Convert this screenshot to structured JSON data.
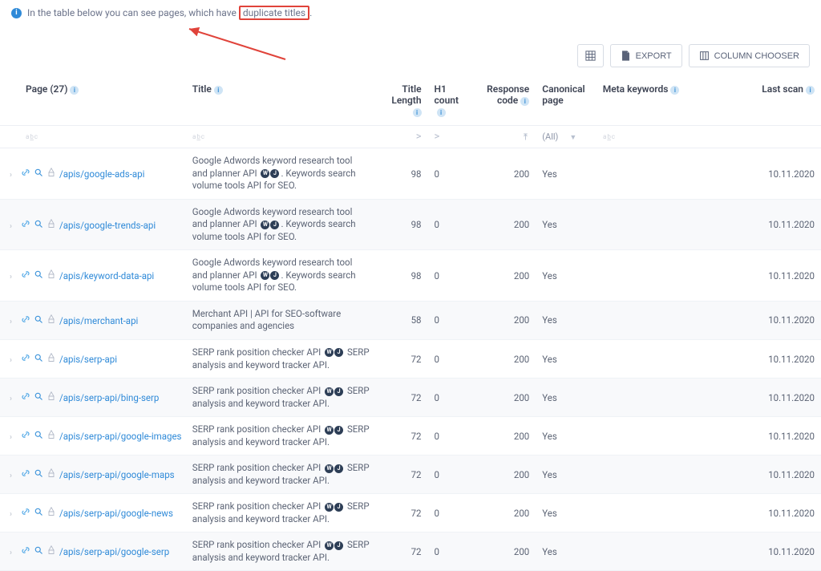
{
  "banner": {
    "text_before": "In the table below you can see pages, which have ",
    "highlight": "duplicate titles",
    "text_after": "."
  },
  "toolbar": {
    "export_label": "EXPORT",
    "column_chooser_label": "COLUMN CHOOSER"
  },
  "columns": {
    "page": "Page (27)",
    "title": "Title",
    "title_length": "Title Length",
    "h1_count": "H1 count",
    "response_code": "Response code",
    "canonical_page": "Canonical page",
    "meta_keywords": "Meta keywords",
    "last_scan": "Last scan"
  },
  "filters": {
    "all_label": "(All)"
  },
  "title_templates": {
    "adwords_a": "Google Adwords keyword research tool and planner API ",
    "adwords_b": ". Keywords search volume tools API for SEO.",
    "merchant": "Merchant API | API for SEO-software companies and agencies",
    "serp_a": "SERP rank position checker API ",
    "serp_b": " SERP analysis and keyword tracker API."
  },
  "rows": [
    {
      "url": "/apis/google-ads-api",
      "title_key": "adwords",
      "len": 98,
      "h1": 0,
      "code": 200,
      "canonical": "Yes",
      "scan": "10.11.2020"
    },
    {
      "url": "/apis/google-trends-api",
      "title_key": "adwords",
      "len": 98,
      "h1": 0,
      "code": 200,
      "canonical": "Yes",
      "scan": "10.11.2020"
    },
    {
      "url": "/apis/keyword-data-api",
      "title_key": "adwords",
      "len": 98,
      "h1": 0,
      "code": 200,
      "canonical": "Yes",
      "scan": "10.11.2020"
    },
    {
      "url": "/apis/merchant-api",
      "title_key": "merchant",
      "len": 58,
      "h1": 0,
      "code": 200,
      "canonical": "Yes",
      "scan": "10.11.2020"
    },
    {
      "url": "/apis/serp-api",
      "title_key": "serp",
      "len": 72,
      "h1": 0,
      "code": 200,
      "canonical": "Yes",
      "scan": "10.11.2020"
    },
    {
      "url": "/apis/serp-api/bing-serp",
      "title_key": "serp",
      "len": 72,
      "h1": 0,
      "code": 200,
      "canonical": "Yes",
      "scan": "10.11.2020"
    },
    {
      "url": "/apis/serp-api/google-images",
      "title_key": "serp",
      "len": 72,
      "h1": 0,
      "code": 200,
      "canonical": "Yes",
      "scan": "10.11.2020"
    },
    {
      "url": "/apis/serp-api/google-maps",
      "title_key": "serp",
      "len": 72,
      "h1": 0,
      "code": 200,
      "canonical": "Yes",
      "scan": "10.11.2020"
    },
    {
      "url": "/apis/serp-api/google-news",
      "title_key": "serp",
      "len": 72,
      "h1": 0,
      "code": 200,
      "canonical": "Yes",
      "scan": "10.11.2020"
    },
    {
      "url": "/apis/serp-api/google-serp",
      "title_key": "serp",
      "len": 72,
      "h1": 0,
      "code": 200,
      "canonical": "Yes",
      "scan": "10.11.2020"
    }
  ]
}
